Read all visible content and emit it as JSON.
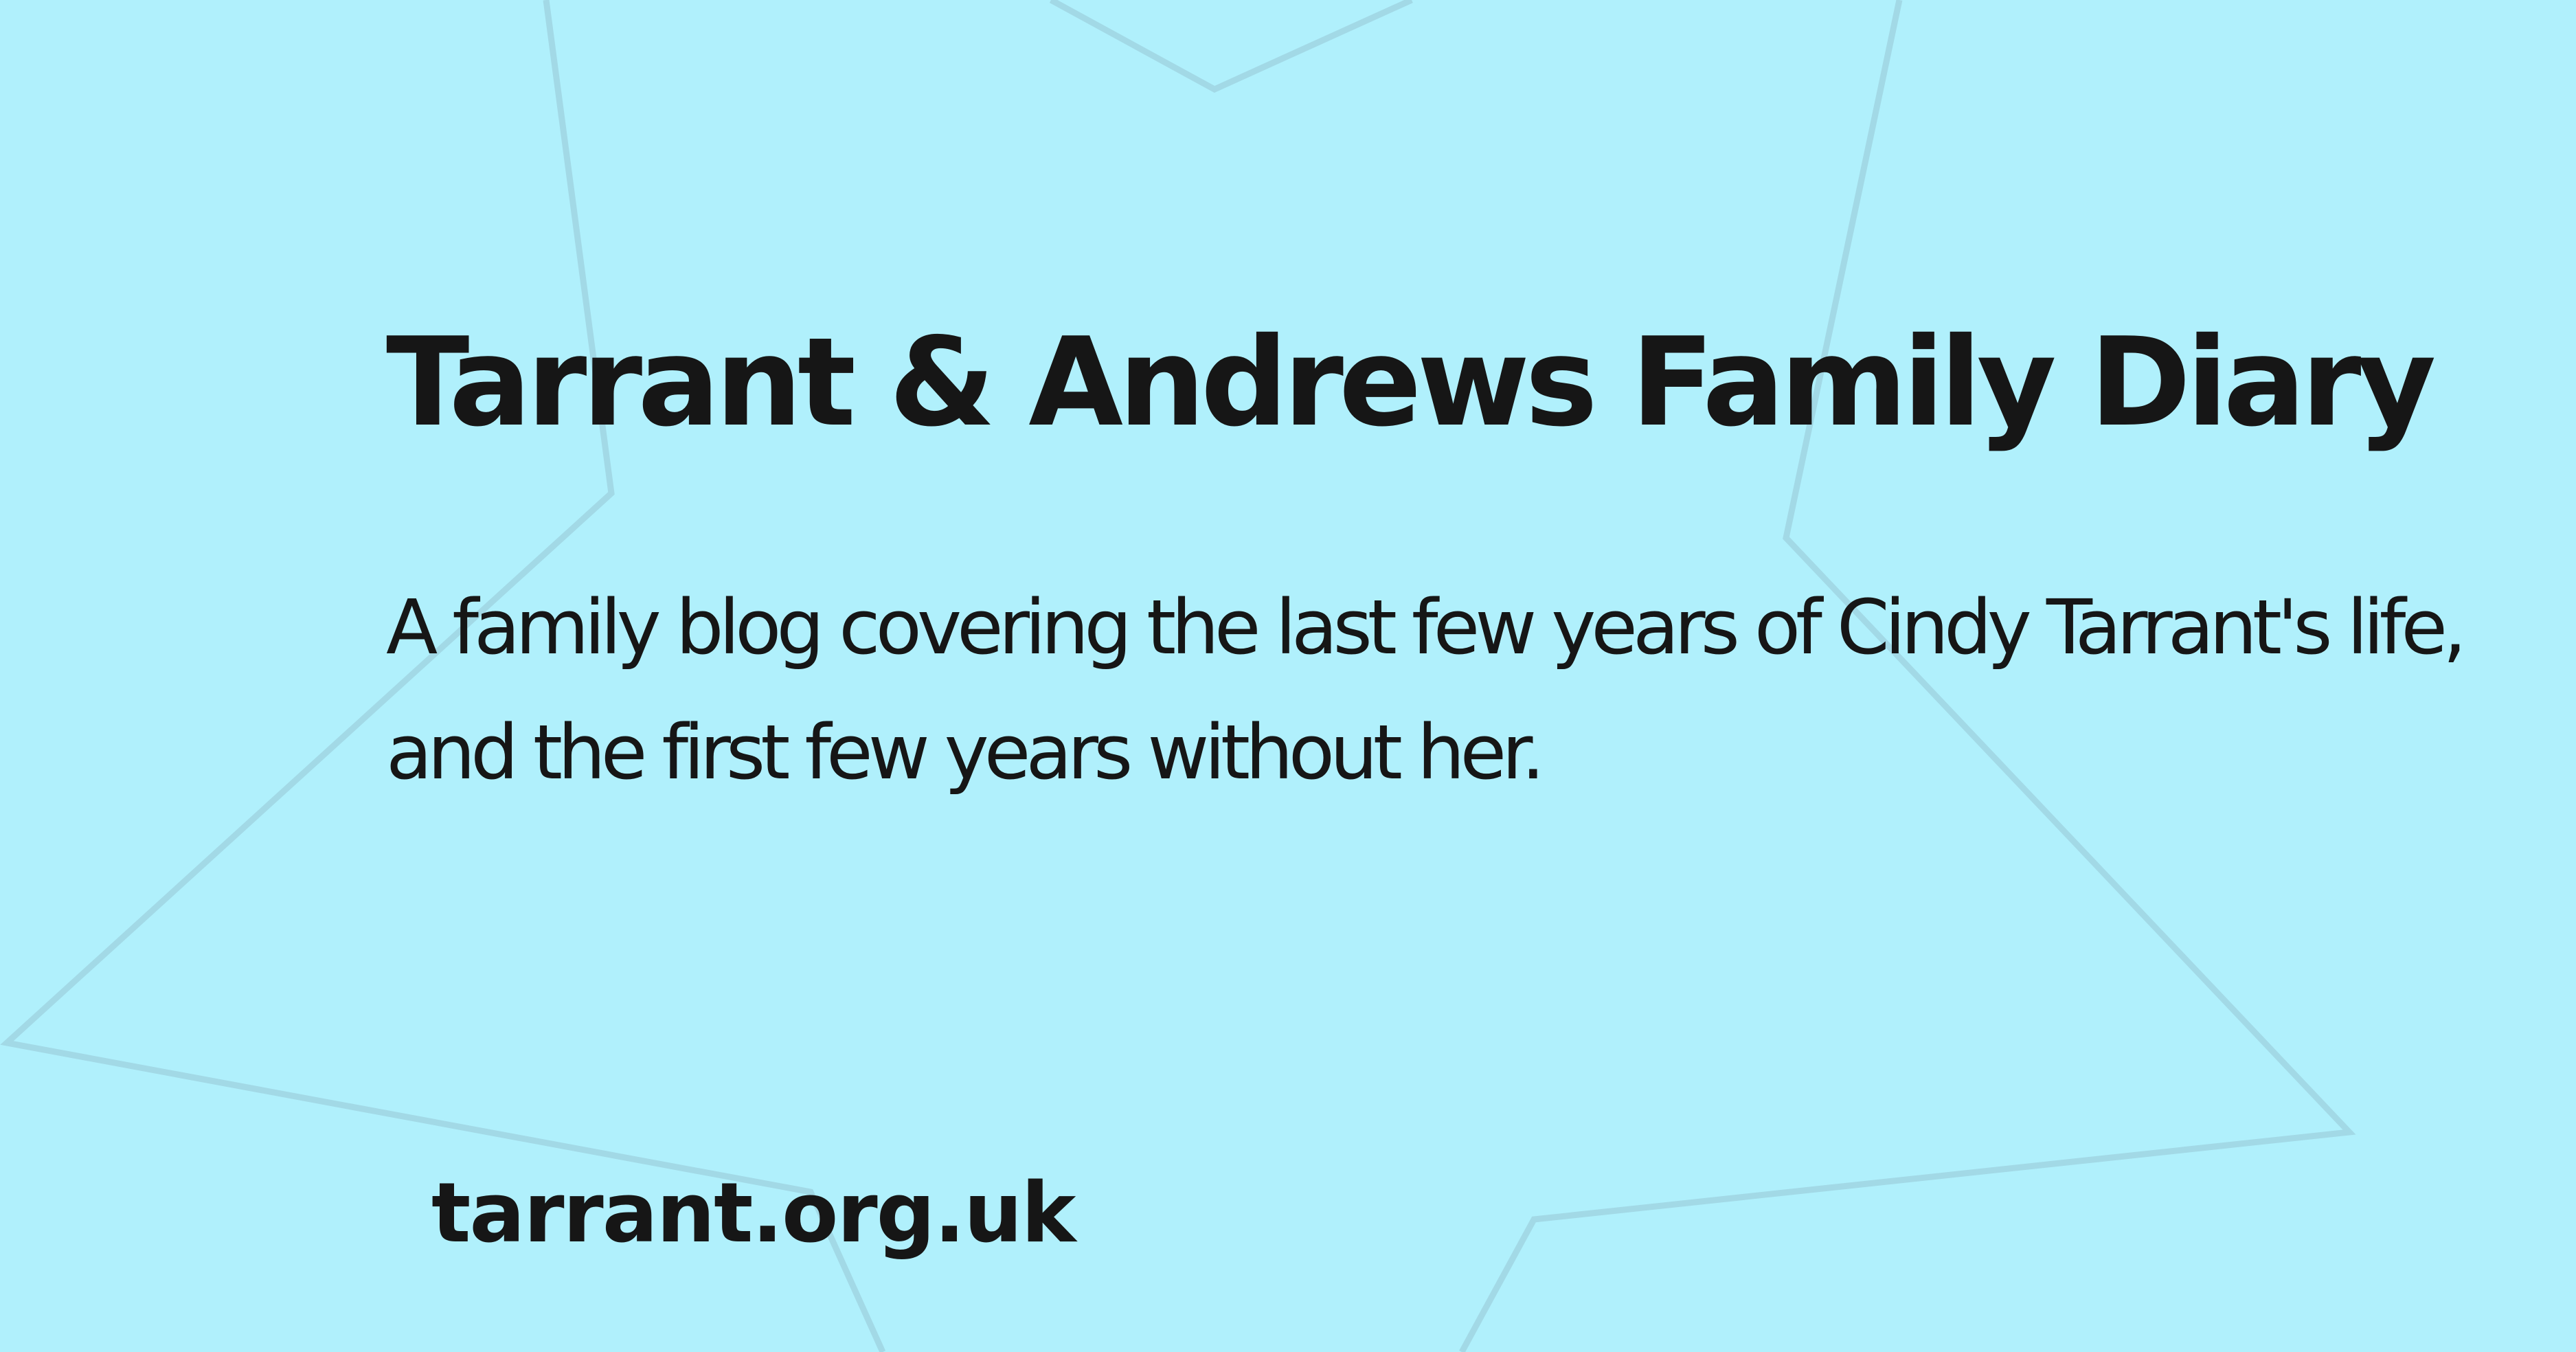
{
  "site": {
    "title": "Tarrant & Andrews Family Diary",
    "description": "A family blog covering the last few years of Cindy Tarrant's life, and the first few years without her.",
    "domain": "tarrant.org.uk"
  },
  "colors": {
    "background": "#b0f0fc",
    "star_outline": "#a2d9e6",
    "text": "#161616"
  },
  "decoration": {
    "background_shape": "star-outline"
  }
}
